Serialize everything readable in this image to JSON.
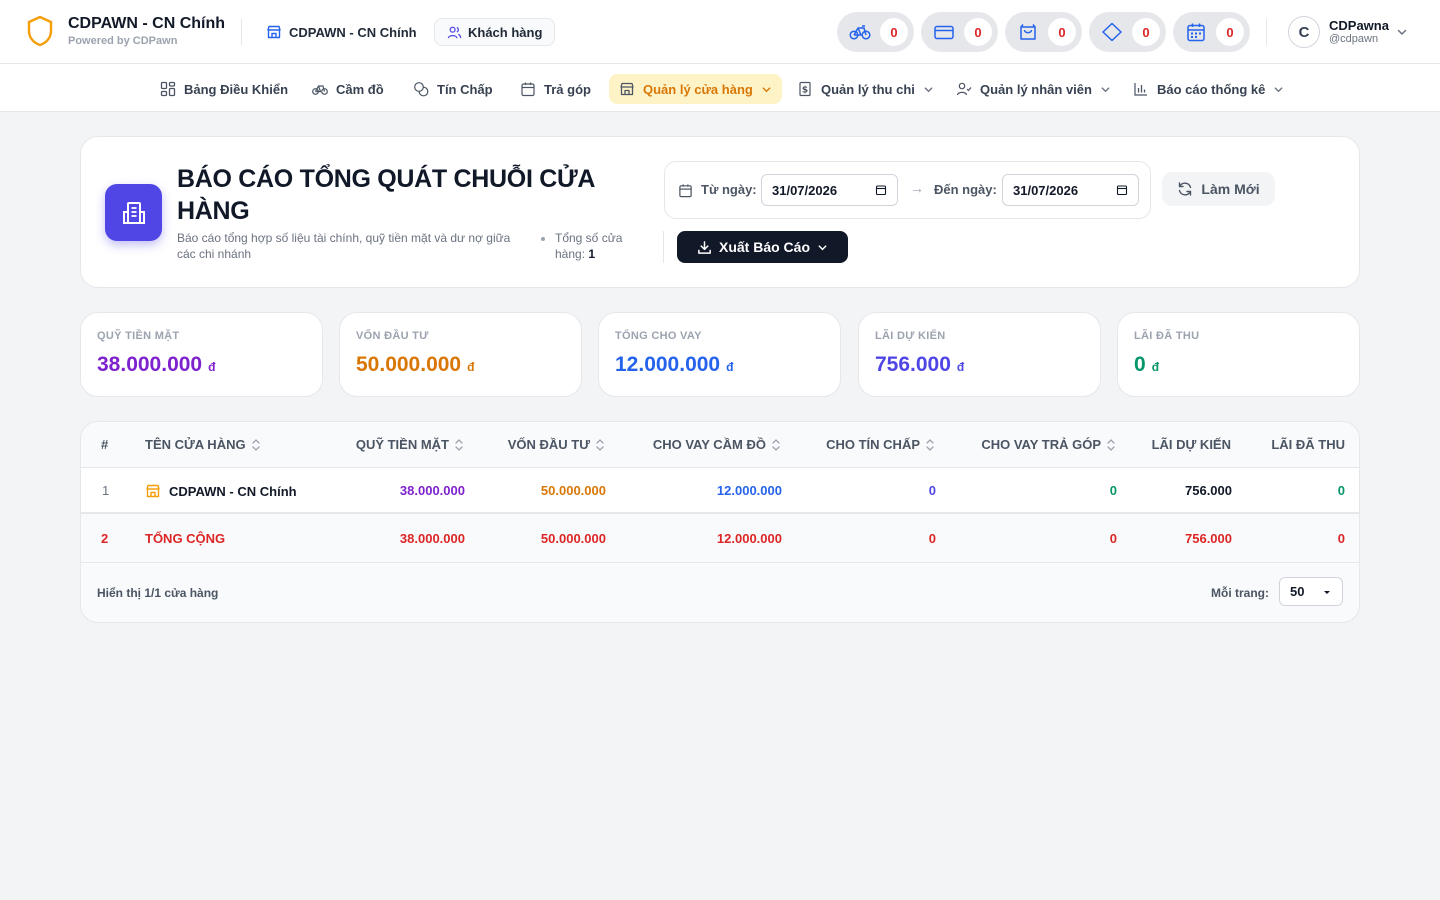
{
  "header": {
    "brand_name": "CDPAWN - CN Chính",
    "brand_sub": "Powered by CDPawn",
    "branch_name": "CDPAWN - CN Chính",
    "customers_label": "Khách hàng",
    "counters": [
      {
        "icon": "bicycle-icon",
        "count": "0"
      },
      {
        "icon": "credit-card-icon",
        "count": "0"
      },
      {
        "icon": "shopping-bag-icon",
        "count": "0"
      },
      {
        "icon": "diamond-icon",
        "count": "0"
      },
      {
        "icon": "calendar-icon",
        "count": "0"
      }
    ],
    "user": {
      "initial": "C",
      "name": "CDPawna",
      "handle": "@cdpawn"
    }
  },
  "nav": {
    "items": [
      {
        "label": "Bảng Điều Khiển",
        "icon": "dashboard-grid-icon"
      },
      {
        "label": "Cầm đồ",
        "icon": "bicycle-icon"
      },
      {
        "label": "Tín Chấp",
        "icon": "coins-icon"
      },
      {
        "label": "Trả góp",
        "icon": "calendar-icon"
      },
      {
        "label": "Quản lý cửa hàng",
        "icon": "store-icon",
        "active": true
      },
      {
        "label": "Quản lý thu chi",
        "icon": "receipt-icon"
      },
      {
        "label": "Quản lý nhân viên",
        "icon": "user-check-icon"
      },
      {
        "label": "Báo cáo thống kê",
        "icon": "bar-chart-icon"
      }
    ]
  },
  "report": {
    "title": "BÁO CÁO TỔNG QUÁT CHUỖI CỬA HÀNG",
    "description": "Báo cáo tổng hợp số liệu tài chính, quỹ tiền mặt và dư nợ giữa các chi nhánh",
    "store_count_label": "Tổng số cửa hàng:",
    "store_count": "1",
    "from_label": "Từ ngày:",
    "from_date": "31/07/2026",
    "to_label": "Đến ngày:",
    "to_date": "31/07/2026",
    "refresh_label": "Làm Mới",
    "export_label": "Xuất Báo Cáo"
  },
  "stats": [
    {
      "label": "QUỸ TIỀN MẶT",
      "value": "38.000.000",
      "currency": "đ",
      "color": "#7e22ce"
    },
    {
      "label": "VỐN ĐẦU TƯ",
      "value": "50.000.000",
      "currency": "đ",
      "color": "#d97706"
    },
    {
      "label": "TỔNG CHO VAY",
      "value": "12.000.000",
      "currency": "đ",
      "color": "#2563eb"
    },
    {
      "label": "LÃI DỰ KIẾN",
      "value": "756.000",
      "currency": "đ",
      "color": "#4f46e5"
    },
    {
      "label": "LÃI ĐÃ THU",
      "value": "0",
      "currency": "đ",
      "color": "#059669"
    }
  ],
  "table": {
    "columns": [
      "#",
      "TÊN CỬA HÀNG",
      "QUỸ TIỀN MẶT",
      "VỐN ĐẦU TƯ",
      "CHO VAY CẦM ĐỒ",
      "CHO TÍN CHẤP",
      "CHO VAY TRẢ GÓP",
      "LÃI DỰ KIẾN",
      "LÃI ĐÃ THU"
    ],
    "rows": [
      {
        "index": "1",
        "name": "CDPAWN - CN Chính",
        "cash": "38.000.000",
        "capital": "50.000.000",
        "pawn_loans": "12.000.000",
        "credit_loans": "0",
        "installment_loans": "0",
        "expected_interest": "756.000",
        "collected_interest": "0"
      }
    ],
    "total": {
      "index": "2",
      "name": "TỔNG CỘNG",
      "cash": "38.000.000",
      "capital": "50.000.000",
      "pawn_loans": "12.000.000",
      "credit_loans": "0",
      "installment_loans": "0",
      "expected_interest": "756.000",
      "collected_interest": "0"
    },
    "footer_info": "Hiển thị 1/1 cửa hàng",
    "per_page_label": "Mỗi trang:",
    "per_page_value": "50"
  }
}
